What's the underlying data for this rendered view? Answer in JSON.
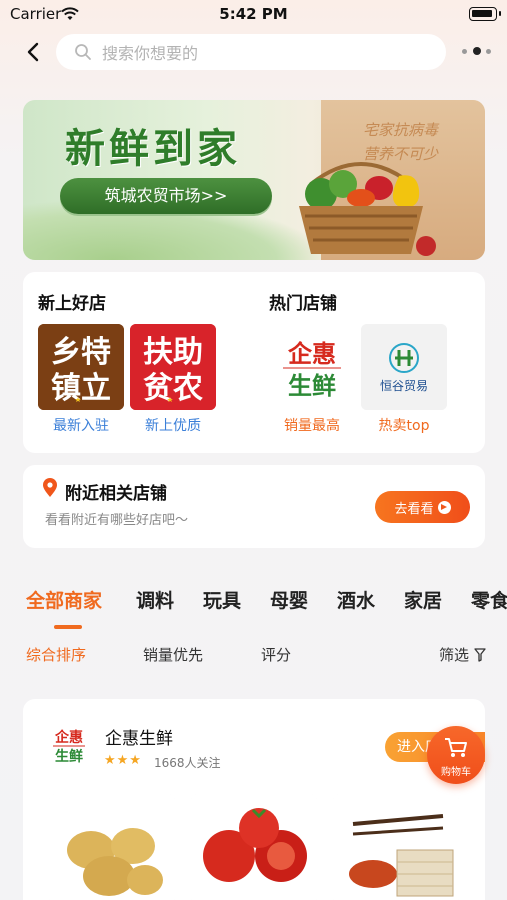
{
  "status_bar": {
    "carrier": "Carrier",
    "time": "5:42 PM"
  },
  "search": {
    "placeholder": "搜索你想要的"
  },
  "banner": {
    "title": "新鲜到家",
    "cta": "筑城农贸市场>>",
    "slogan_line1": "宅家抗病毒",
    "slogan_line2": "营养不可少"
  },
  "new_shops": {
    "title": "新上好店",
    "items": [
      {
        "label": "最新入驻",
        "tile_text": [
          "乡特",
          "镇立"
        ],
        "tile_color": "#7a3d12"
      },
      {
        "label": "新上优质",
        "tile_text": [
          "扶助",
          "贫农"
        ],
        "tile_color": "#d8232a"
      }
    ]
  },
  "hot_shops": {
    "title": "热门店铺",
    "items": [
      {
        "label": "销量最高",
        "logo_top": "企惠",
        "logo_bottom": "生鲜"
      },
      {
        "label": "热卖top",
        "logo_text": "恒谷贸易"
      }
    ]
  },
  "nearby": {
    "title": "附近相关店铺",
    "subtitle": "看看附近有哪些好店吧～",
    "button": "去看看"
  },
  "categories": [
    "全部商家",
    "调料",
    "玩具",
    "母婴",
    "酒水",
    "家居",
    "零食"
  ],
  "sorts": [
    "综合排序",
    "销量优先",
    "评分",
    "筛选"
  ],
  "shop": {
    "name": "企惠生鲜",
    "logo_top": "企惠",
    "logo_bottom": "生鲜",
    "stars": "★★★",
    "followers": "1668人关注",
    "enter": "进入店铺"
  },
  "cart": {
    "label": "购物车"
  },
  "colors": {
    "accent": "#f06a1f",
    "blue": "#3b7fd8",
    "green": "#2f7d2a"
  }
}
